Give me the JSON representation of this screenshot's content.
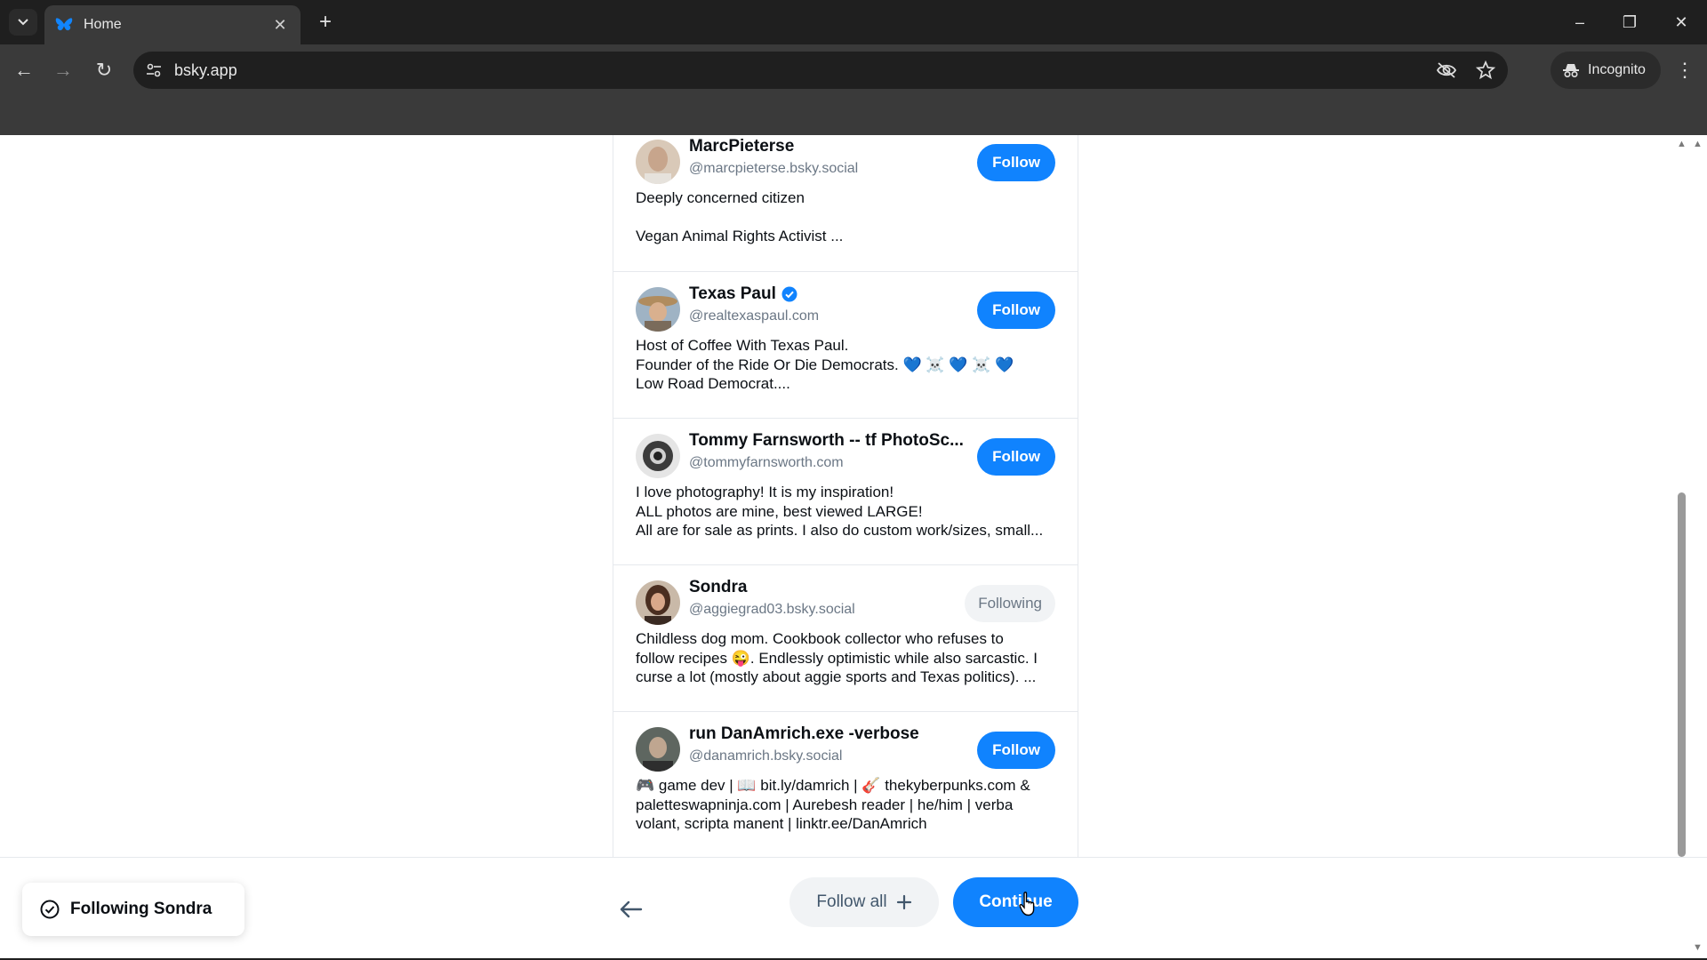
{
  "browser": {
    "tab_title": "Home",
    "url": "bsky.app",
    "incognito_label": "Incognito"
  },
  "profiles": [
    {
      "name": "MarcPieterse",
      "handle": "@marcpieterse.bsky.social",
      "bio": [
        "Deeply concerned citizen",
        "",
        "Vegan Animal Rights Activist ..."
      ],
      "button": "Follow",
      "verified": false,
      "avatar_color": "#d9c9b8"
    },
    {
      "name": "Texas Paul",
      "handle": "@realtexaspaul.com",
      "bio": [
        "Host of Coffee With Texas Paul.",
        "Founder of the Ride Or Die Democrats.  💙 ☠️ 💙 ☠️ 💙",
        "Low Road Democrat...."
      ],
      "button": "Follow",
      "verified": true,
      "avatar_color": "#b8a58a"
    },
    {
      "name": "Tommy Farnsworth -- tf PhotoSc...",
      "handle": "@tommyfarnsworth.com",
      "bio": [
        "I love photography! It is my inspiration!",
        "ALL photos are mine, best viewed LARGE!",
        "All are for sale as prints. I also do custom work/sizes, small..."
      ],
      "button": "Follow",
      "verified": false,
      "avatar_color": "#5a5a5a"
    },
    {
      "name": "Sondra",
      "handle": "@aggiegrad03.bsky.social",
      "bio": [
        "Childless dog mom. Cookbook collector who refuses to",
        "follow recipes 😜. Endlessly optimistic while also sarcastic. I",
        "curse a lot (mostly about aggie sports and Texas politics). ..."
      ],
      "button": "Following",
      "verified": false,
      "avatar_color": "#7a5a48"
    },
    {
      "name": "run DanAmrich.exe -verbose",
      "handle": "@danamrich.bsky.social",
      "bio": [
        "🎮 game dev | 📖 bit.ly/damrich | 🎸 thekyberpunks.com &",
        "paletteswapninja.com | Aurebesh reader | he/him | verba",
        "volant, scripta manent | linktr.ee/DanAmrich"
      ],
      "button": "Follow",
      "verified": false,
      "avatar_color": "#6e6a60"
    }
  ],
  "toast": {
    "text": "Following Sondra"
  },
  "footer": {
    "follow_all_label": "Follow all",
    "continue_label": "Continue"
  }
}
